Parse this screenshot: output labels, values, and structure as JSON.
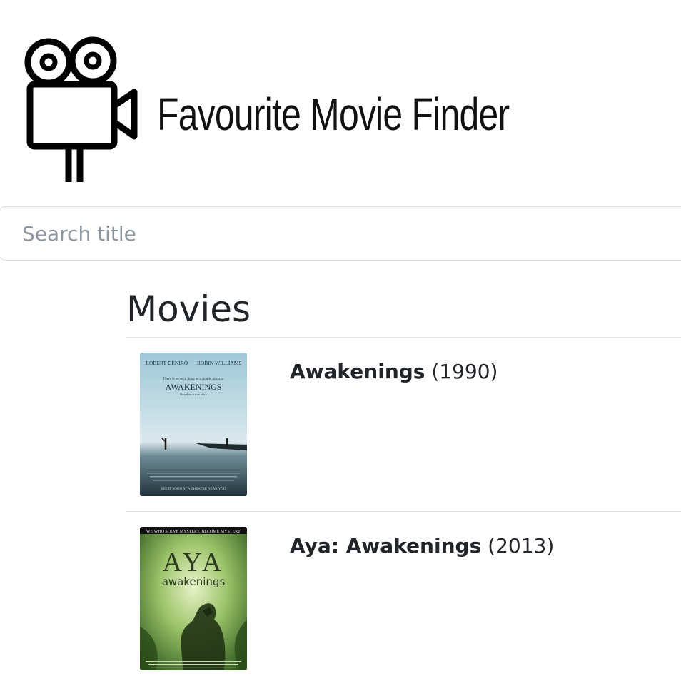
{
  "header": {
    "logo_icon": "movie-camera-icon",
    "title": "Favourite Movie Finder"
  },
  "search": {
    "placeholder": "Search title",
    "value": ""
  },
  "main": {
    "heading": "Movies",
    "movies": [
      {
        "title": "Awakenings",
        "year": "(1990)",
        "poster": {
          "cast_left": "ROBERT DENIRO",
          "cast_right": "ROBIN WILLIAMS",
          "tagline": "There is no such thing as a simple miracle.",
          "title": "AWAKENINGS",
          "subtitle": "Based on a true story",
          "footer": "SEE IT SOON AT A THEATRE NEAR YOU"
        }
      },
      {
        "title": "Aya: Awakenings",
        "year": "(2013)",
        "poster": {
          "top_banner": "WE WHO SOLVE MYSTERY, BECOME MYSTERY",
          "title": "AYA",
          "subtitle": "awakenings"
        }
      }
    ]
  },
  "colors": {
    "text": "#212529",
    "placeholder": "#8c96a0",
    "border": "#d9dde2",
    "divider": "#e3e6e9"
  }
}
